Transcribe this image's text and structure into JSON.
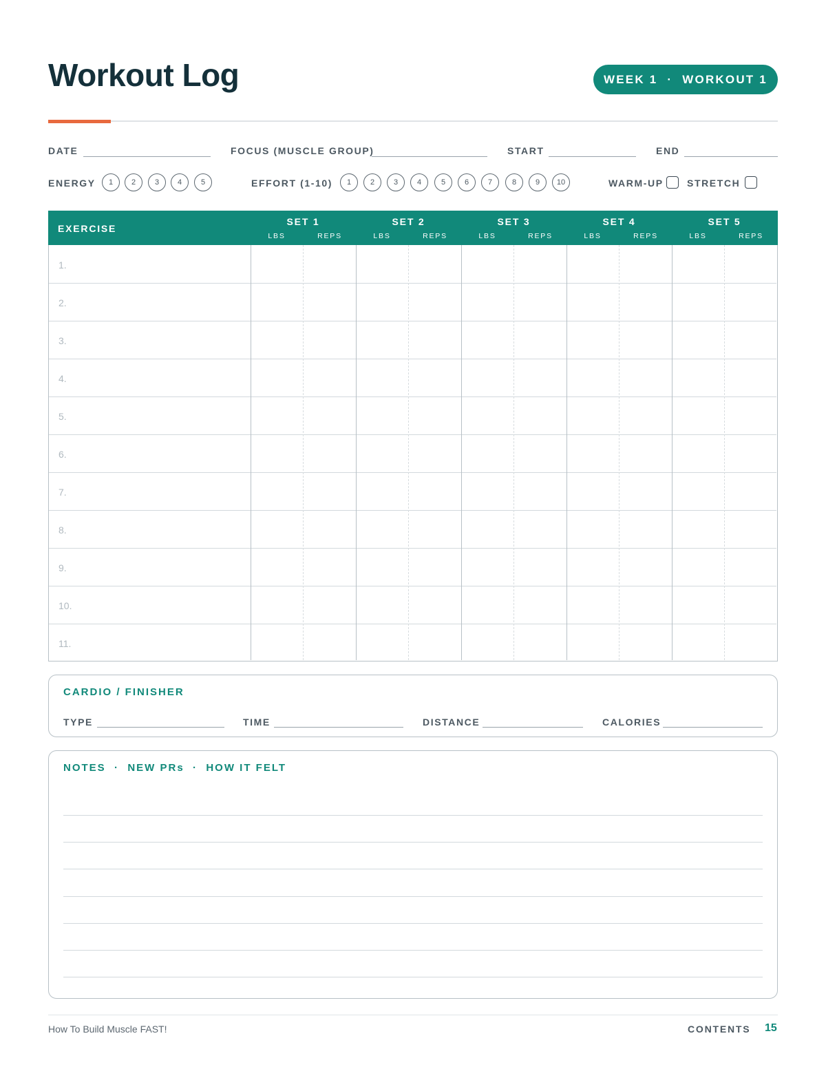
{
  "header": {
    "title": "Workout Log",
    "badge_week": "WEEK 1",
    "badge_sep": "·",
    "badge_workout": "WORKOUT 1"
  },
  "fields": {
    "date": "DATE",
    "focus": "FOCUS (MUSCLE GROUP)",
    "start": "START",
    "end": "END",
    "energy": "ENERGY",
    "effort": "EFFORT (1-10)",
    "warmup": "WARM-UP",
    "stretch": "STRETCH"
  },
  "energy_scale": [
    "1",
    "2",
    "3",
    "4",
    "5"
  ],
  "effort_scale": [
    "1",
    "2",
    "3",
    "4",
    "5",
    "6",
    "7",
    "8",
    "9",
    "10"
  ],
  "table": {
    "exercise_header": "EXERCISE",
    "sets": [
      "SET 1",
      "SET 2",
      "SET 3",
      "SET 4",
      "SET 5"
    ],
    "sub_lbs": "LBS",
    "sub_reps": "REPS",
    "rows": [
      "1.",
      "2.",
      "3.",
      "4.",
      "5.",
      "6.",
      "7.",
      "8.",
      "9.",
      "10.",
      "11."
    ]
  },
  "cardio": {
    "title": "CARDIO / FINISHER",
    "type": "TYPE",
    "time": "TIME",
    "distance": "DISTANCE",
    "calories": "CALORIES"
  },
  "notes": {
    "title": "NOTES  ·  NEW PRs  ·  HOW IT FELT"
  },
  "footer": {
    "book": "How To Build Muscle FAST!",
    "contents": "CONTENTS",
    "page": "15"
  },
  "colors": {
    "accent_teal": "#11897a",
    "accent_orange": "#e8693e",
    "title_ink": "#14303a"
  }
}
